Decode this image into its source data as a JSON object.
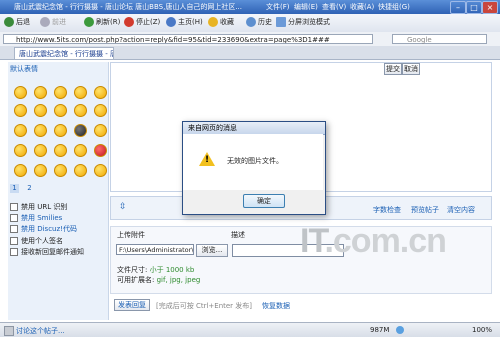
{
  "window": {
    "title": "唐山武震纪念馆 - 行行摄摄 - 唐山论坛 唐山BBS,唐山人自己的网上社区...",
    "menus": [
      "文件(F)",
      "编辑(E)",
      "查看(V)",
      "收藏(A)",
      "快捷组(G)"
    ]
  },
  "toolbar": {
    "back": "后退",
    "forward": "前进",
    "refresh": "刷新(R)",
    "stop": "停止(Z)",
    "home": "主页(H)",
    "favorites": "收藏",
    "history": "历史",
    "split": "分屏浏览模式"
  },
  "address": {
    "url": "http://www.5its.com/post.php?action=reply&fid=95&tid=233690&extra=page%3D1###",
    "search_placeholder": "Google"
  },
  "tab": {
    "label": "唐山武震纪念馆 - 行行摄摄 - 唐..."
  },
  "smilies": {
    "tab_label": "默认表情",
    "pages": [
      "1",
      "2"
    ]
  },
  "options": [
    {
      "label": "禁用 URL 识别",
      "link": false
    },
    {
      "label": "禁用 Smilies",
      "link": true
    },
    {
      "label": "禁用 Discuz!代码",
      "link": true
    },
    {
      "label": "使用个人签名",
      "link": false
    },
    {
      "label": "接收新回复邮件通知",
      "link": false
    }
  ],
  "editor": {
    "btn_submit": "提交",
    "btn_cancel": "取消"
  },
  "toolrow": {
    "wordcount": "字数检查",
    "preview": "预览帖子",
    "clear": "清空内容"
  },
  "attach": {
    "col_attach": "上传附件",
    "col_desc": "描述",
    "file_value": "F:\\Users\\Administrator\\",
    "browse": "浏览...",
    "size_label": "文件尺寸:",
    "size_value": "小于 1000 kb",
    "ext_label": "可用扩展名:",
    "ext_value": "gif, jpg, jpeg"
  },
  "submit": {
    "post": "发表回复",
    "hint": "[完成后可按 Ctrl+Enter 发布]",
    "restore": "恢复数据"
  },
  "dialog": {
    "title": "来自网页的消息",
    "message": "无效的图片文件。",
    "ok": "确定"
  },
  "status": {
    "left": "讨论这个帖子...",
    "memory": "987M",
    "zoom": "100%"
  },
  "watermark": {
    "text": "IT.com.cn"
  }
}
